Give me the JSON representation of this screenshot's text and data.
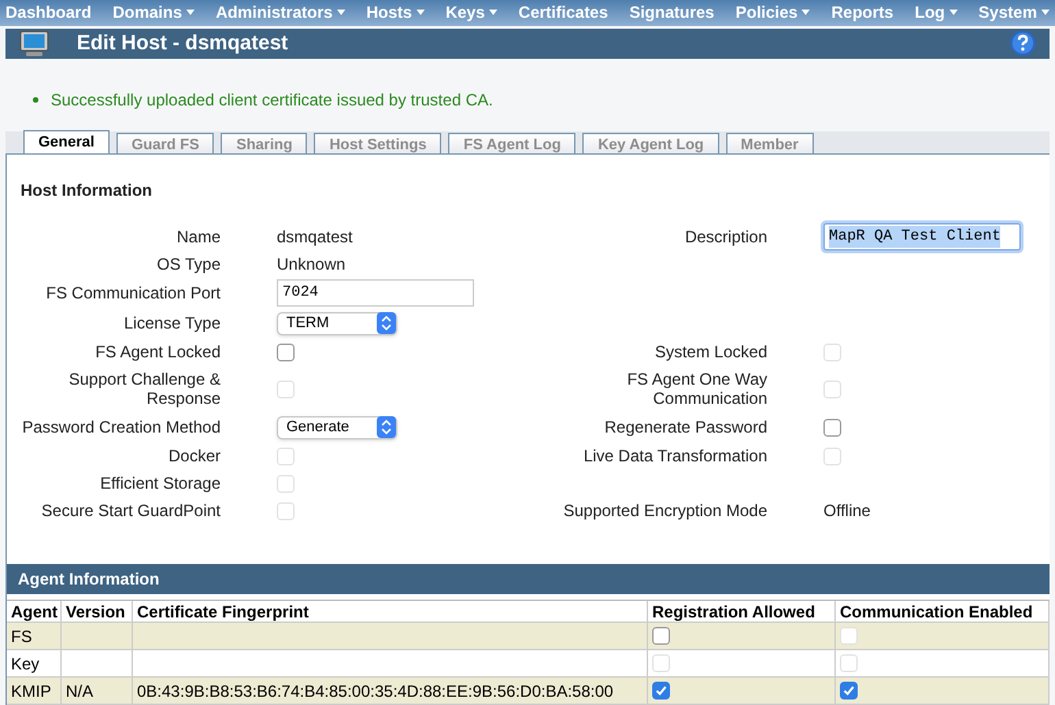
{
  "nav": {
    "items": [
      {
        "label": "Dashboard",
        "dropdown": false
      },
      {
        "label": "Domains",
        "dropdown": true
      },
      {
        "label": "Administrators",
        "dropdown": true
      },
      {
        "label": "Hosts",
        "dropdown": true
      },
      {
        "label": "Keys",
        "dropdown": true
      },
      {
        "label": "Certificates",
        "dropdown": false
      },
      {
        "label": "Signatures",
        "dropdown": false
      },
      {
        "label": "Policies",
        "dropdown": true
      },
      {
        "label": "Reports",
        "dropdown": false
      },
      {
        "label": "Log",
        "dropdown": true
      },
      {
        "label": "System",
        "dropdown": true
      }
    ]
  },
  "page_title": "Edit Host - dsmqatest",
  "messages": [
    "Successfully uploaded client certificate issued by trusted CA."
  ],
  "tabs": [
    {
      "label": "General",
      "selected": true
    },
    {
      "label": "Guard FS",
      "selected": false
    },
    {
      "label": "Sharing",
      "selected": false
    },
    {
      "label": "Host Settings",
      "selected": false
    },
    {
      "label": "FS Agent Log",
      "selected": false
    },
    {
      "label": "Key Agent Log",
      "selected": false
    },
    {
      "label": "Member",
      "selected": false
    }
  ],
  "host_information": {
    "title": "Host Information",
    "rows": [
      {
        "left": {
          "label": "Name",
          "kind": "text",
          "value": "dsmqatest"
        },
        "right": {
          "label": "Description",
          "kind": "input",
          "value": "MapR QA Test Client",
          "focused": true
        }
      },
      {
        "left": {
          "label": "OS Type",
          "kind": "text",
          "value": "Unknown"
        }
      },
      {
        "left": {
          "label": "FS Communication Port",
          "kind": "input",
          "value": "7024",
          "focused": false
        }
      },
      {
        "left": {
          "label": "License Type",
          "kind": "select",
          "value": "TERM"
        }
      },
      {
        "left": {
          "label": "FS Agent Locked",
          "kind": "checkbox",
          "checked": false,
          "disabled": false
        },
        "right": {
          "label": "System Locked",
          "kind": "checkbox",
          "checked": false,
          "disabled": true
        }
      },
      {
        "left": {
          "label": "Support Challenge & Response",
          "kind": "checkbox",
          "checked": false,
          "disabled": true
        },
        "right": {
          "label": "FS Agent One Way Communication",
          "kind": "checkbox",
          "checked": false,
          "disabled": true
        }
      },
      {
        "left": {
          "label": "Password Creation Method",
          "kind": "select",
          "value": "Generate"
        },
        "right": {
          "label": "Regenerate Password",
          "kind": "checkbox",
          "checked": false,
          "disabled": false
        }
      },
      {
        "left": {
          "label": "Docker",
          "kind": "checkbox",
          "checked": false,
          "disabled": true
        },
        "right": {
          "label": "Live Data Transformation",
          "kind": "checkbox",
          "checked": false,
          "disabled": true
        }
      },
      {
        "left": {
          "label": "Efficient Storage",
          "kind": "checkbox",
          "checked": false,
          "disabled": true
        }
      },
      {
        "left": {
          "label": "Secure Start GuardPoint",
          "kind": "checkbox",
          "checked": false,
          "disabled": true
        },
        "right": {
          "label": "Supported Encryption Mode",
          "kind": "text",
          "value": "Offline"
        }
      }
    ]
  },
  "agent_information": {
    "title": "Agent Information",
    "columns": [
      "Agent",
      "Version",
      "Certificate Fingerprint",
      "Registration Allowed",
      "Communication Enabled"
    ],
    "rows": [
      {
        "agent": "FS",
        "registration_allowed": {
          "checked": false,
          "disabled": false
        },
        "communication_enabled": {
          "checked": false,
          "disabled": true
        }
      },
      {
        "agent": "Key",
        "registration_allowed": {
          "checked": false,
          "disabled": true
        },
        "communication_enabled": {
          "checked": false,
          "disabled": true
        }
      },
      {
        "agent": "KMIP",
        "version": "N/A",
        "fingerprint": "0B:43:9B:B8:53:B6:74:B4:85:00:35:4D:88:EE:9B:56:D0:BA:58:00",
        "registration_allowed": {
          "checked": true,
          "disabled": false
        },
        "communication_enabled": {
          "checked": true,
          "disabled": false
        }
      }
    ]
  }
}
